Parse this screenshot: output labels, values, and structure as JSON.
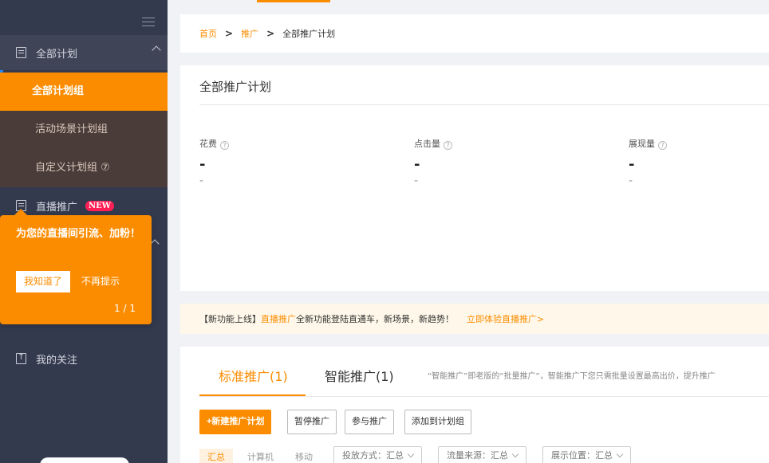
{
  "sidebar": {
    "group_plan": "全部计划",
    "items": [
      "全部计划组",
      "活动场景计划组",
      "自定义计划组 ⑦"
    ],
    "group_live": "直播推广",
    "live_badge": "NEW",
    "group_follow": "我的关注"
  },
  "tooltip": {
    "text": "为您的直播间引流、加粉！",
    "ok": "我知道了",
    "dismiss": "不再提示",
    "page": "1 / 1"
  },
  "breadcrumb": {
    "home": "首页",
    "promo": "推广",
    "current": "全部推广计划"
  },
  "overview": {
    "title": "全部推广计划",
    "metrics": [
      {
        "label": "花费",
        "value": "-",
        "sub": "-"
      },
      {
        "label": "点击量",
        "value": "-",
        "sub": "-"
      },
      {
        "label": "展现量",
        "value": "-",
        "sub": "-"
      }
    ]
  },
  "notice": {
    "prefix": "【新功能上线】",
    "highlight": "直播推广",
    "text": "全新功能登陆直通车，新场景，新趋势！",
    "link": "立即体验直播推广>"
  },
  "plans": {
    "tab_standard": "标准推广(1)",
    "tab_smart": "智能推广(1)",
    "desc": "“智能推广”即老版的“批量推广”，智能推广下您只需批量设置最高出价，提升推广",
    "btn_new": "+新建推广计划",
    "btn_pause": "暂停推广",
    "btn_join": "参与推广",
    "btn_add_group": "添加到计划组",
    "seg_all": "汇总",
    "seg_pc": "计算机",
    "seg_mobile": "移动",
    "filter_mode": "投放方式：汇总",
    "filter_source": "流量来源：汇总",
    "filter_position": "展示位置：汇总"
  },
  "colors": {
    "accent": "#fb8c00",
    "sidebar": "#343a4e"
  }
}
